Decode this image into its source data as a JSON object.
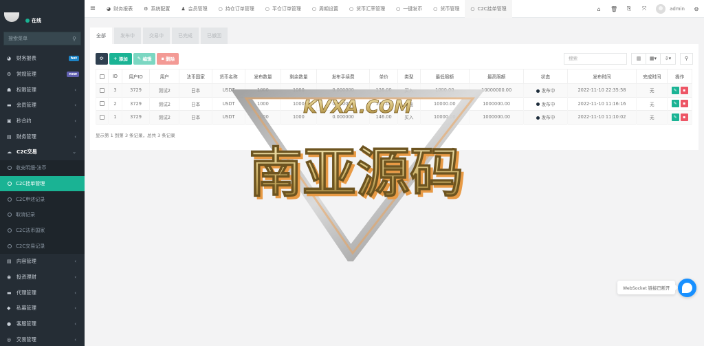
{
  "sidebar": {
    "status": "在线",
    "search_placeholder": "搜索菜单",
    "items": [
      {
        "label": "财务报表",
        "icon": "dashboard-icon",
        "glyph": "◕",
        "badge": "hot"
      },
      {
        "label": "常规管理",
        "icon": "cogs-icon",
        "glyph": "⚙",
        "badge": "new"
      },
      {
        "label": "权限管理",
        "icon": "users-icon",
        "glyph": "☗",
        "arrow": "‹"
      },
      {
        "label": "会员管理",
        "icon": "list-icon",
        "glyph": "▬",
        "arrow": "‹"
      },
      {
        "label": "秒合约",
        "icon": "calendar-icon",
        "glyph": "▣",
        "arrow": "‹"
      },
      {
        "label": "财务管理",
        "icon": "book-icon",
        "glyph": "▤",
        "arrow": "‹"
      },
      {
        "label": "C2C交易",
        "icon": "c2c-icon",
        "glyph": "☁",
        "arrow": "⌄"
      }
    ],
    "c2c_sub": [
      {
        "label": "收支明细-法币"
      },
      {
        "label": "C2C挂单管理",
        "active": true
      },
      {
        "label": "C2C申述记录"
      },
      {
        "label": "取消记录"
      },
      {
        "label": "C2C法币国家"
      },
      {
        "label": "C2C交易记录"
      }
    ],
    "items_after": [
      {
        "label": "内容管理",
        "icon": "content-icon",
        "glyph": "▤",
        "arrow": "‹"
      },
      {
        "label": "投资理财",
        "icon": "invest-icon",
        "glyph": "◉",
        "arrow": "‹"
      },
      {
        "label": "代理管理",
        "icon": "briefcase-icon",
        "glyph": "▬",
        "arrow": "‹"
      },
      {
        "label": "私募管理",
        "icon": "diamond-icon",
        "glyph": "◆",
        "arrow": "‹"
      },
      {
        "label": "客服管理",
        "icon": "comment-icon",
        "glyph": "●",
        "arrow": "‹"
      },
      {
        "label": "交易管理",
        "icon": "eye-icon",
        "glyph": "◎",
        "arrow": "‹"
      }
    ]
  },
  "topbar": {
    "tabs": [
      {
        "label": "财务报表",
        "icon": "dashboard-icon",
        "glyph": "◕"
      },
      {
        "label": "系统配置",
        "icon": "gear-icon",
        "glyph": "⚙"
      },
      {
        "label": "会员管理",
        "icon": "user-icon",
        "glyph": "♟"
      },
      {
        "label": "持仓订单管理",
        "icon": "circle-icon",
        "glyph": "○"
      },
      {
        "label": "平仓订单管理",
        "icon": "circle-icon",
        "glyph": "○"
      },
      {
        "label": "周期设置",
        "icon": "circle-icon",
        "glyph": "○"
      },
      {
        "label": "货币汇率管理",
        "icon": "circle-icon",
        "glyph": "○"
      },
      {
        "label": "一键发币",
        "icon": "circle-icon",
        "glyph": "○"
      },
      {
        "label": "货币管理",
        "icon": "circle-icon",
        "glyph": "○"
      },
      {
        "label": "C2C挂单管理",
        "icon": "circle-icon",
        "glyph": "○",
        "active": true
      }
    ],
    "username": "admin"
  },
  "status_tabs": [
    "全部",
    "发布中",
    "交易中",
    "已完成",
    "已撤回"
  ],
  "toolbar": {
    "add": "添加",
    "edit": "编辑",
    "delete": "删除",
    "search_placeholder": "搜索"
  },
  "table": {
    "columns": [
      "ID",
      "用户ID",
      "用户",
      "法币国家",
      "货币名称",
      "发布数量",
      "剩余数量",
      "发布手续费",
      "单价",
      "类型",
      "最低限额",
      "最高限额",
      "状态",
      "发布时间",
      "完成时间",
      "操作"
    ],
    "rows": [
      {
        "id": "3",
        "uid": "3729",
        "user": "测试2",
        "country": "日本",
        "coin": "USDT",
        "qty": "1000",
        "remain": "1000",
        "fee": "0.000000",
        "price": "136.00",
        "type": "买入",
        "min": "1000.00",
        "max": "10000000.00",
        "status": "发布中",
        "time": "2022-11-10 22:35:58",
        "done": "无"
      },
      {
        "id": "2",
        "uid": "3729",
        "user": "测试2",
        "country": "日本",
        "coin": "USDT",
        "qty": "1000",
        "remain": "1000",
        "fee": "0.000000",
        "price": "148.00",
        "type": "卖出",
        "min": "10000.00",
        "max": "1000000.00",
        "status": "发布中",
        "time": "2022-11-10 11:16:16",
        "done": "无"
      },
      {
        "id": "1",
        "uid": "3729",
        "user": "测试2",
        "country": "日本",
        "coin": "USDT",
        "qty": "1000",
        "remain": "1000",
        "fee": "0.000000",
        "price": "146.00",
        "type": "买入",
        "min": "10000.00",
        "max": "1000000.00",
        "status": "发布中",
        "time": "2022-11-10 11:10:02",
        "done": "无"
      }
    ],
    "page_info": "显示第 1 到第 3 条记录，总共 3 条记录"
  },
  "watermark": {
    "top": "KVXA.COM",
    "main": "南亚源码"
  },
  "websocket_notice": "WebSocket 链接已断开",
  "colors": {
    "accent": "#1ab394",
    "sidebar": "#252d35",
    "danger": "#ed5565",
    "chat": "#1890ff"
  }
}
